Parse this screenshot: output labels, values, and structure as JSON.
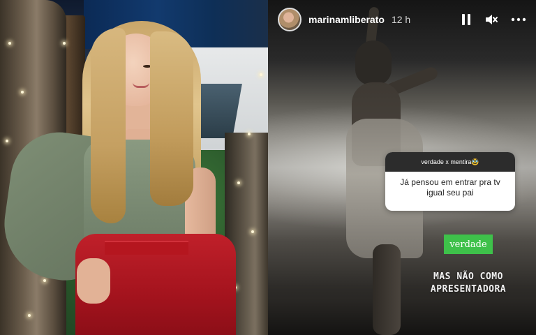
{
  "story": {
    "username": "marinamliberato",
    "time": "12 h",
    "controls": {
      "pause": "pause-icon",
      "mute": "mute-icon",
      "more": "more-icon"
    },
    "question": {
      "title": "verdade x mentira🥸",
      "text": "Já pensou em entrar pra tv igual seu pai"
    },
    "answer_tag": "verdade",
    "answer_text_line1": "MAS NÃO COMO",
    "answer_text_line2": "APRESENTADORA"
  },
  "colors": {
    "answer_tag_bg": "#3ec14a",
    "skirt": "#c0202a",
    "top": "#8a9a81"
  }
}
